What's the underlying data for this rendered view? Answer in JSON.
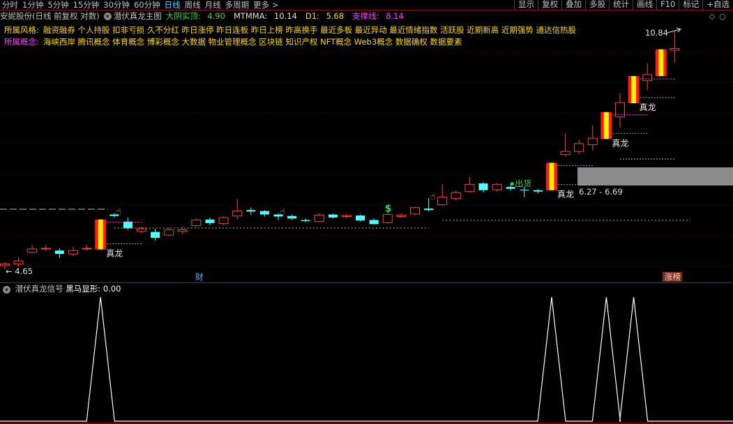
{
  "periods": [
    "分时",
    "1分钟",
    "5分钟",
    "15分钟",
    "30分钟",
    "60分钟",
    "日线",
    "周线",
    "月线",
    "多周期",
    "更多 >"
  ],
  "active_period": "日线",
  "tools": [
    "显示",
    "复权",
    "叠加",
    "多股",
    "统计",
    "画线",
    "F10",
    "标记",
    "+自选"
  ],
  "title": {
    "stock": "安妮股份(日线 前复权 对数)",
    "indicator": "潜伏真龙主图",
    "k1_label": "大阴实顶:",
    "k1_value": "4.90",
    "k2_label": "MTMMA:",
    "k2_value": "10.14",
    "k3_label": "D1:",
    "k3_value": "5.68",
    "k4_label": "支撑线:",
    "k4_value": "8.14"
  },
  "style_row": {
    "label": "所属风格:",
    "items": "融资融券 个人持股 扣非亏损 久不分红 昨日涨停 昨日连板 昨日上榜 昨高换手 最近多板 最近异动 最近情绪指数 活跃股 近期新高 近期强势 通达信热股"
  },
  "concept_row": {
    "label": "所属概念:",
    "items": "海峡西岸 腾讯概念 体育概念 博彩概念 大数据 物业管理概念 区块链 知识产权 NFT概念 Web3概念 数据确权 数据要素"
  },
  "chart_data": {
    "type": "candlestick",
    "candles": [
      {
        "o": 4.72,
        "c": 4.75,
        "h": 4.78,
        "l": 4.66
      },
      {
        "o": 4.75,
        "c": 4.8,
        "h": 4.86,
        "l": 4.7
      },
      {
        "o": 4.95,
        "c": 5.01,
        "h": 5.08,
        "l": 4.93
      },
      {
        "o": 5.02,
        "c": 5.02,
        "h": 5.08,
        "l": 4.97
      },
      {
        "o": 4.98,
        "c": 4.92,
        "h": 5.02,
        "l": 4.85
      },
      {
        "o": 4.92,
        "c": 4.98,
        "h": 5.05,
        "l": 4.88
      },
      {
        "o": 5.02,
        "c": 5.02,
        "h": 5.08,
        "l": 4.98
      },
      {
        "o": 5.0,
        "c": 5.56,
        "h": 5.56,
        "l": 5.0,
        "lu": true
      },
      {
        "o": 5.66,
        "c": 5.63,
        "h": 5.69,
        "l": 5.6
      },
      {
        "o": 5.52,
        "c": 5.39,
        "h": 5.6,
        "l": 5.36
      },
      {
        "o": 5.33,
        "c": 5.38,
        "h": 5.42,
        "l": 5.3
      },
      {
        "o": 5.32,
        "c": 5.21,
        "h": 5.38,
        "l": 5.16
      },
      {
        "o": 5.26,
        "c": 5.36,
        "h": 5.4,
        "l": 5.24
      },
      {
        "o": 5.33,
        "c": 5.36,
        "h": 5.42,
        "l": 5.28
      },
      {
        "o": 5.44,
        "c": 5.55,
        "h": 5.58,
        "l": 5.42
      },
      {
        "o": 5.56,
        "c": 5.49,
        "h": 5.6,
        "l": 5.45
      },
      {
        "o": 5.48,
        "c": 5.6,
        "h": 5.63,
        "l": 5.45
      },
      {
        "o": 5.63,
        "c": 5.73,
        "h": 5.98,
        "l": 5.57
      },
      {
        "o": 5.75,
        "c": 5.72,
        "h": 5.8,
        "l": 5.65
      },
      {
        "o": 5.73,
        "c": 5.66,
        "h": 5.75,
        "l": 5.62
      },
      {
        "o": 5.66,
        "c": 5.62,
        "h": 5.68,
        "l": 5.55
      },
      {
        "o": 5.63,
        "c": 5.58,
        "h": 5.66,
        "l": 5.55
      },
      {
        "o": 5.55,
        "c": 5.53,
        "h": 5.58,
        "l": 5.5
      },
      {
        "o": 5.52,
        "c": 5.65,
        "h": 5.69,
        "l": 5.5
      },
      {
        "o": 5.66,
        "c": 5.6,
        "h": 5.68,
        "l": 5.58
      },
      {
        "o": 5.62,
        "c": 5.64,
        "h": 5.67,
        "l": 5.58
      },
      {
        "o": 5.64,
        "c": 5.54,
        "h": 5.66,
        "l": 5.52
      },
      {
        "o": 5.55,
        "c": 5.47,
        "h": 5.58,
        "l": 5.46
      },
      {
        "o": 5.5,
        "c": 5.66,
        "h": 5.69,
        "l": 5.48
      },
      {
        "o": 5.62,
        "c": 5.65,
        "h": 5.68,
        "l": 5.6
      },
      {
        "o": 5.67,
        "c": 5.8,
        "h": 5.82,
        "l": 5.64
      },
      {
        "o": 5.78,
        "c": 5.75,
        "h": 6.0,
        "l": 5.72
      },
      {
        "o": 5.86,
        "c": 6.02,
        "h": 6.3,
        "l": 5.83
      },
      {
        "o": 5.99,
        "c": 6.12,
        "h": 6.16,
        "l": 5.95
      },
      {
        "o": 6.14,
        "c": 6.3,
        "h": 6.47,
        "l": 6.12
      },
      {
        "o": 6.32,
        "c": 6.17,
        "h": 6.35,
        "l": 6.12
      },
      {
        "o": 6.18,
        "c": 6.3,
        "h": 6.33,
        "l": 6.14
      },
      {
        "o": 6.24,
        "c": 6.2,
        "h": 6.28,
        "l": 6.16
      },
      {
        "o": 6.18,
        "c": 6.17,
        "h": 6.24,
        "l": 6.02
      },
      {
        "o": 6.17,
        "c": 6.14,
        "h": 6.2,
        "l": 6.1
      },
      {
        "o": 6.17,
        "c": 6.8,
        "h": 6.8,
        "l": 6.17,
        "lu": true
      },
      {
        "o": 7.0,
        "c": 7.08,
        "h": 7.55,
        "l": 6.95
      },
      {
        "o": 7.08,
        "c": 7.28,
        "h": 7.38,
        "l": 7.0
      },
      {
        "o": 7.25,
        "c": 7.42,
        "h": 7.76,
        "l": 7.1
      },
      {
        "o": 7.4,
        "c": 8.14,
        "h": 8.14,
        "l": 7.4,
        "lu": true
      },
      {
        "o": 8.0,
        "c": 8.42,
        "h": 8.71,
        "l": 7.7
      },
      {
        "o": 8.4,
        "c": 9.25,
        "h": 9.25,
        "l": 8.4,
        "lu": true
      },
      {
        "o": 9.1,
        "c": 9.3,
        "h": 9.68,
        "l": 8.8
      },
      {
        "o": 9.25,
        "c": 10.17,
        "h": 10.17,
        "l": 9.25,
        "lu": true
      },
      {
        "o": 10.14,
        "c": 10.2,
        "h": 10.84,
        "l": 9.7
      }
    ],
    "ylim_log": [
      4.65,
      10.84
    ],
    "max_label": "10.84",
    "min_label": "4.65",
    "range_label": "6.27 - 6.69",
    "dragon_label": "真龙",
    "sell_label": "出货",
    "dollar_label": "$",
    "dragon_idx": [
      7,
      40,
      44,
      46
    ],
    "hand_idx": [
      8,
      20,
      31
    ],
    "fin_label": "财",
    "limit_label": "涨榜",
    "subchart": {
      "title": "潜伏真龙信号",
      "value_label": "黑马显形:",
      "value": "0.00",
      "signal_idx": [
        7,
        40,
        44,
        46
      ]
    }
  }
}
